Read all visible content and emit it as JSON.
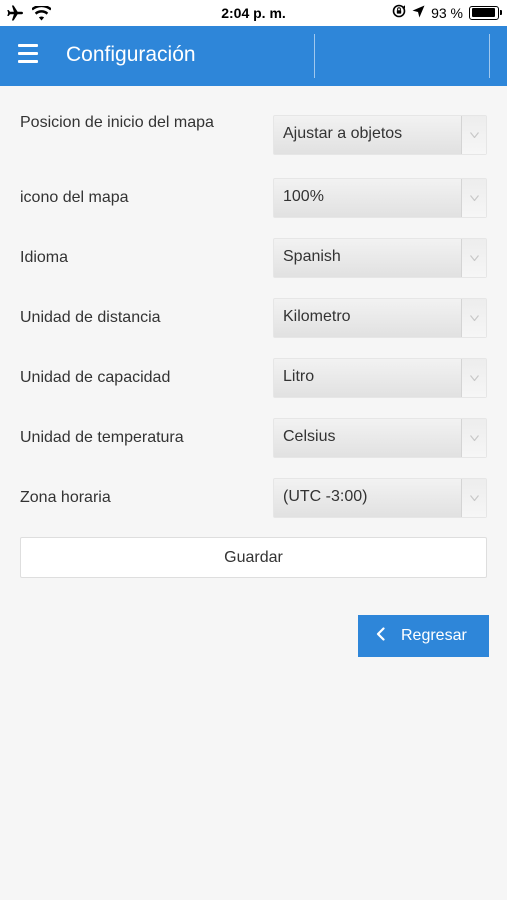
{
  "status_bar": {
    "time": "2:04 p. m.",
    "battery_percent": "93 %",
    "battery_level": 0.93,
    "icons": [
      "airplane-icon",
      "wifi-icon",
      "orientation-lock-icon",
      "location-arrow-icon",
      "battery-icon"
    ]
  },
  "header": {
    "title": "Configuración",
    "background_color": "#2e86d9"
  },
  "form": {
    "rows": [
      {
        "label": "Posicion de inicio del mapa",
        "value": "Ajustar a objetos"
      },
      {
        "label": "icono del mapa",
        "value": "100%"
      },
      {
        "label": "Idioma",
        "value": "Spanish"
      },
      {
        "label": "Unidad de distancia",
        "value": "Kilometro"
      },
      {
        "label": "Unidad de capacidad",
        "value": "Litro"
      },
      {
        "label": "Unidad de temperatura",
        "value": "Celsius"
      },
      {
        "label": "Zona horaria",
        "value": "(UTC -3:00)"
      }
    ]
  },
  "actions": {
    "save_label": "Guardar",
    "back_label": "Regresar"
  }
}
